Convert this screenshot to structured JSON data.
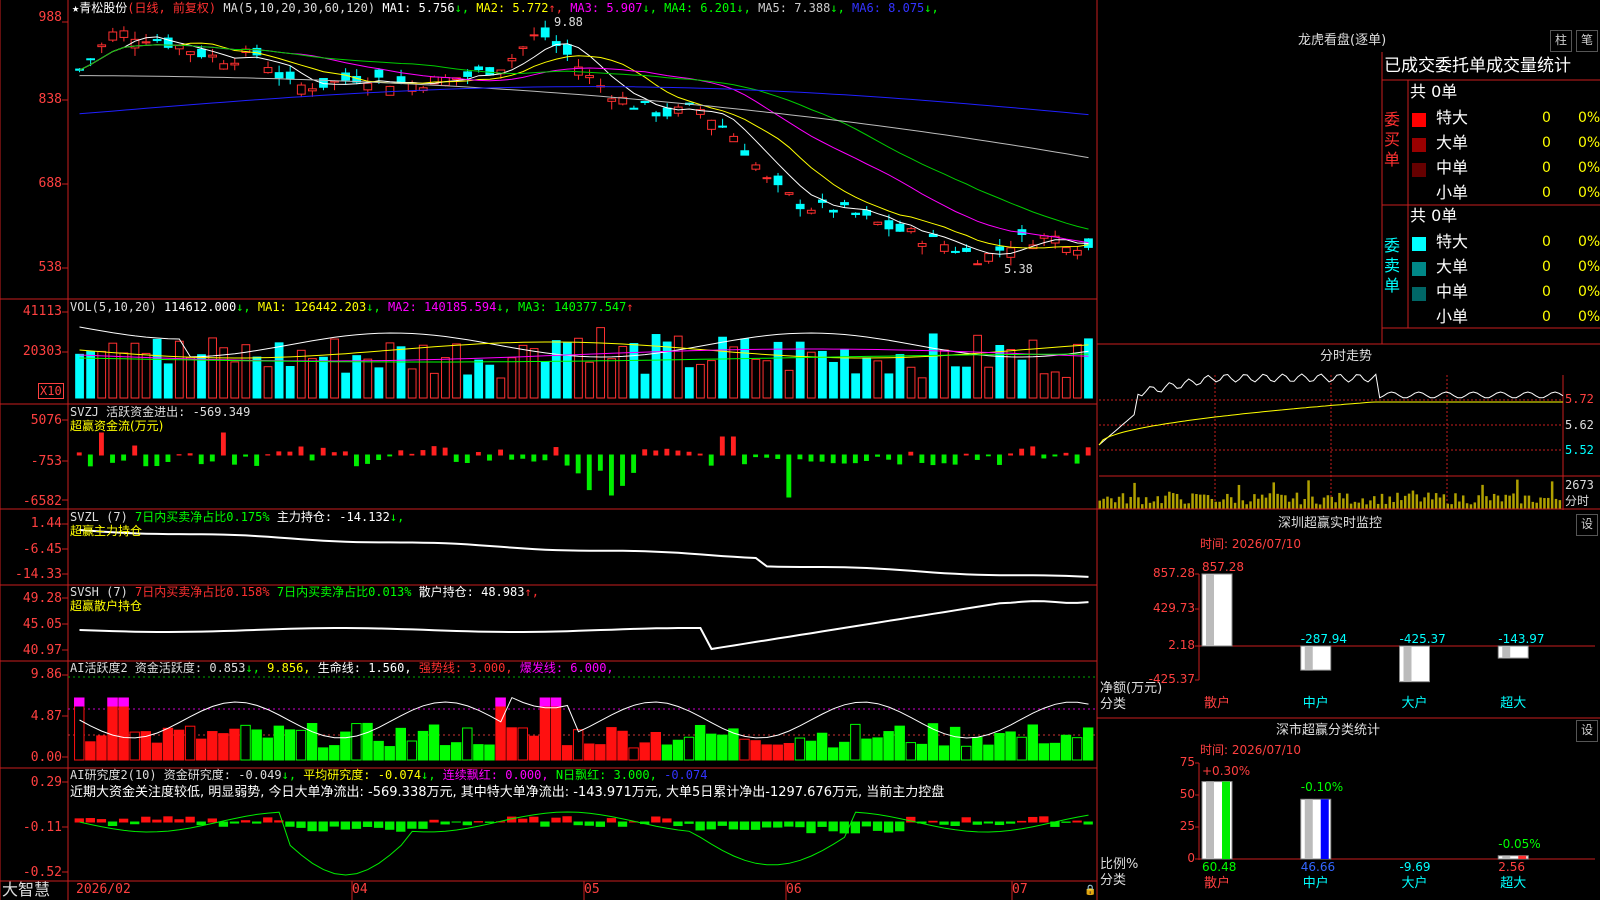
{
  "stock": {
    "name": "青松股份",
    "period": "(日线, 前复权)"
  },
  "main": {
    "ma_header": "MA(5,10,20,30,60,120)",
    "ma_items": [
      {
        "label": "MA1: 5.756",
        "arrow": "↓",
        "color": "#ffffff"
      },
      {
        "label": "MA2: 5.772",
        "arrow": "↑",
        "color": "#ffff00"
      },
      {
        "label": "MA3: 5.907",
        "arrow": "↓",
        "color": "#ff00ff"
      },
      {
        "label": "MA4: 6.201",
        "arrow": "↓",
        "color": "#00ff00"
      },
      {
        "label": "MA5: 7.388",
        "arrow": "↓",
        "color": "#cccccc"
      },
      {
        "label": "MA6: 8.075",
        "arrow": "↓",
        "color": "#3333ff"
      }
    ],
    "y_ticks": [
      "988",
      "838",
      "688",
      "538"
    ],
    "high_mark": "9.88",
    "low_mark": "5.38"
  },
  "vol": {
    "header": "VOL(5,10,20)",
    "value": "114612.000",
    "ma1": "MA1: 126442.203",
    "ma2": "MA2: 140185.594",
    "ma3": "MA3: 140377.547",
    "y_ticks": [
      "41113",
      "20303"
    ],
    "unit": "X10"
  },
  "svzj": {
    "header": "SVZJ  活跃资金进出: -569.349",
    "sub": "超赢资金流(万元)",
    "y_ticks": [
      "5076",
      "-753",
      "-6582"
    ]
  },
  "svzl": {
    "header": "SVZL (7)",
    "h2": "7日内买卖净占比0.175%",
    "h3": "主力持仓: -14.132",
    "sub": "超赢主力持仓",
    "y_ticks": [
      "1.44",
      "-6.45",
      "-14.33"
    ]
  },
  "svsh": {
    "header": "SVSH (7)",
    "h2": "7日内买卖净占比0.158%",
    "h3": "7日内买卖净占比0.013%",
    "h4": "散户持仓: 48.983",
    "sub": "超赢散户持仓",
    "y_ticks": [
      "49.28",
      "45.05",
      "40.97"
    ]
  },
  "ai1": {
    "header": "AI活跃度2 资金活跃度: 0.853",
    "h2": "9.856,",
    "h3": "生命线: 1.560,",
    "h4": "强势线: 3.000,",
    "h5": "爆发线: 6.000,",
    "y_ticks": [
      "9.86",
      "4.87",
      "0.00"
    ]
  },
  "ai2": {
    "header": "AI研究度2(10) 资金研究度: -0.049",
    "h2": "平均研究度: -0.074",
    "h3": "连续飘红: 0.000,",
    "h4": "N日飘红: 3.000,",
    "h5": "-0.074",
    "y_ticks": [
      "0.29",
      "-0.11",
      "-0.52"
    ],
    "comment": "近期大资金关注度较低, 明显弱势, 今日大单净流出: -569.338万元, 其中特大单净流出: -143.971万元, 大单5日累计净出-1297.676万元, 当前主力控盘"
  },
  "xaxis": {
    "brand": "大智慧",
    "labels": [
      "2026/02",
      "04",
      "05",
      "06",
      "07"
    ]
  },
  "longhu": {
    "title": "龙虎看盘(逐单)",
    "btn1": "柱",
    "btn2": "笔",
    "subtitle": "已成交委托单成交量统计",
    "buy": {
      "side": "委买单",
      "total": "共 0单",
      "rows": [
        {
          "name": "特大",
          "qty": "0",
          "pct": "0%",
          "color": "#ff0000"
        },
        {
          "name": "大单",
          "qty": "0",
          "pct": "0%",
          "color": "#990000"
        },
        {
          "name": "中单",
          "qty": "0",
          "pct": "0%",
          "color": "#660000"
        },
        {
          "name": "小单",
          "qty": "0",
          "pct": "0%",
          "color": "#000000"
        }
      ]
    },
    "sell": {
      "side": "委卖单",
      "total": "共 0单",
      "rows": [
        {
          "name": "特大",
          "qty": "0",
          "pct": "0%",
          "color": "#00ffff"
        },
        {
          "name": "大单",
          "qty": "0",
          "pct": "0%",
          "color": "#008888"
        },
        {
          "name": "中单",
          "qty": "0",
          "pct": "0%",
          "color": "#006666"
        },
        {
          "name": "小单",
          "qty": "0",
          "pct": "0%",
          "color": "#000000"
        }
      ]
    }
  },
  "fenshi": {
    "title": "分时走势",
    "y_ticks": [
      "5.72",
      "5.62",
      "5.52"
    ],
    "vol_tick": "2673",
    "vol_label": "分时"
  },
  "monitor": {
    "title": "深圳超赢实时监控",
    "btn": "设",
    "time": "时间: 2026/07/10",
    "y_ticks": [
      "857.28",
      "429.73",
      "2.18",
      "-425.37"
    ],
    "ylabel": "净额(万元)",
    "xlabel": "分类",
    "categories": [
      "散户",
      "中户",
      "大户",
      "超大"
    ],
    "values": [
      857.28,
      -287.94,
      -425.37,
      -143.97
    ],
    "value_labels": [
      "857.28",
      "-287.94",
      "-425.37",
      "-143.97"
    ]
  },
  "classify": {
    "title": "深市超赢分类统计",
    "btn": "设",
    "time": "时间: 2026/07/10",
    "y_ticks": [
      "75",
      "50",
      "25",
      "0"
    ],
    "ylabel": "比例%",
    "xlabel": "分类",
    "categories": [
      "散户",
      "中户",
      "大户",
      "超大"
    ],
    "values": [
      60.48,
      46.66,
      -9.69,
      2.56
    ],
    "value_labels": [
      "60.48",
      "46.66",
      "-9.69",
      "2.56"
    ],
    "delta_labels": [
      "+0.30%",
      "-0.10%",
      "",
      "-0.05%"
    ]
  },
  "chart_data": [
    {
      "type": "candlestick",
      "title": "青松股份 (日线, 前复权)",
      "ylim": [
        5.38,
        9.88
      ],
      "high": 9.88,
      "low": 5.38,
      "series": [
        {
          "name": "MA1",
          "value": 5.756
        },
        {
          "name": "MA2",
          "value": 5.772
        },
        {
          "name": "MA3",
          "value": 5.907
        },
        {
          "name": "MA4",
          "value": 6.201
        },
        {
          "name": "MA5",
          "value": 7.388
        },
        {
          "name": "MA6",
          "value": 8.075
        }
      ]
    },
    {
      "type": "bar",
      "title": "深圳超赢实时监控",
      "categories": [
        "散户",
        "中户",
        "大户",
        "超大"
      ],
      "values": [
        857.28,
        -287.94,
        -425.37,
        -143.97
      ],
      "ylabel": "净额(万元)",
      "ylim": [
        -425.37,
        857.28
      ]
    },
    {
      "type": "bar",
      "title": "深市超赢分类统计",
      "categories": [
        "散户",
        "中户",
        "大户",
        "超大"
      ],
      "values": [
        60.48,
        46.66,
        -9.69,
        2.56
      ],
      "ylabel": "比例%",
      "ylim": [
        0,
        75
      ]
    }
  ]
}
